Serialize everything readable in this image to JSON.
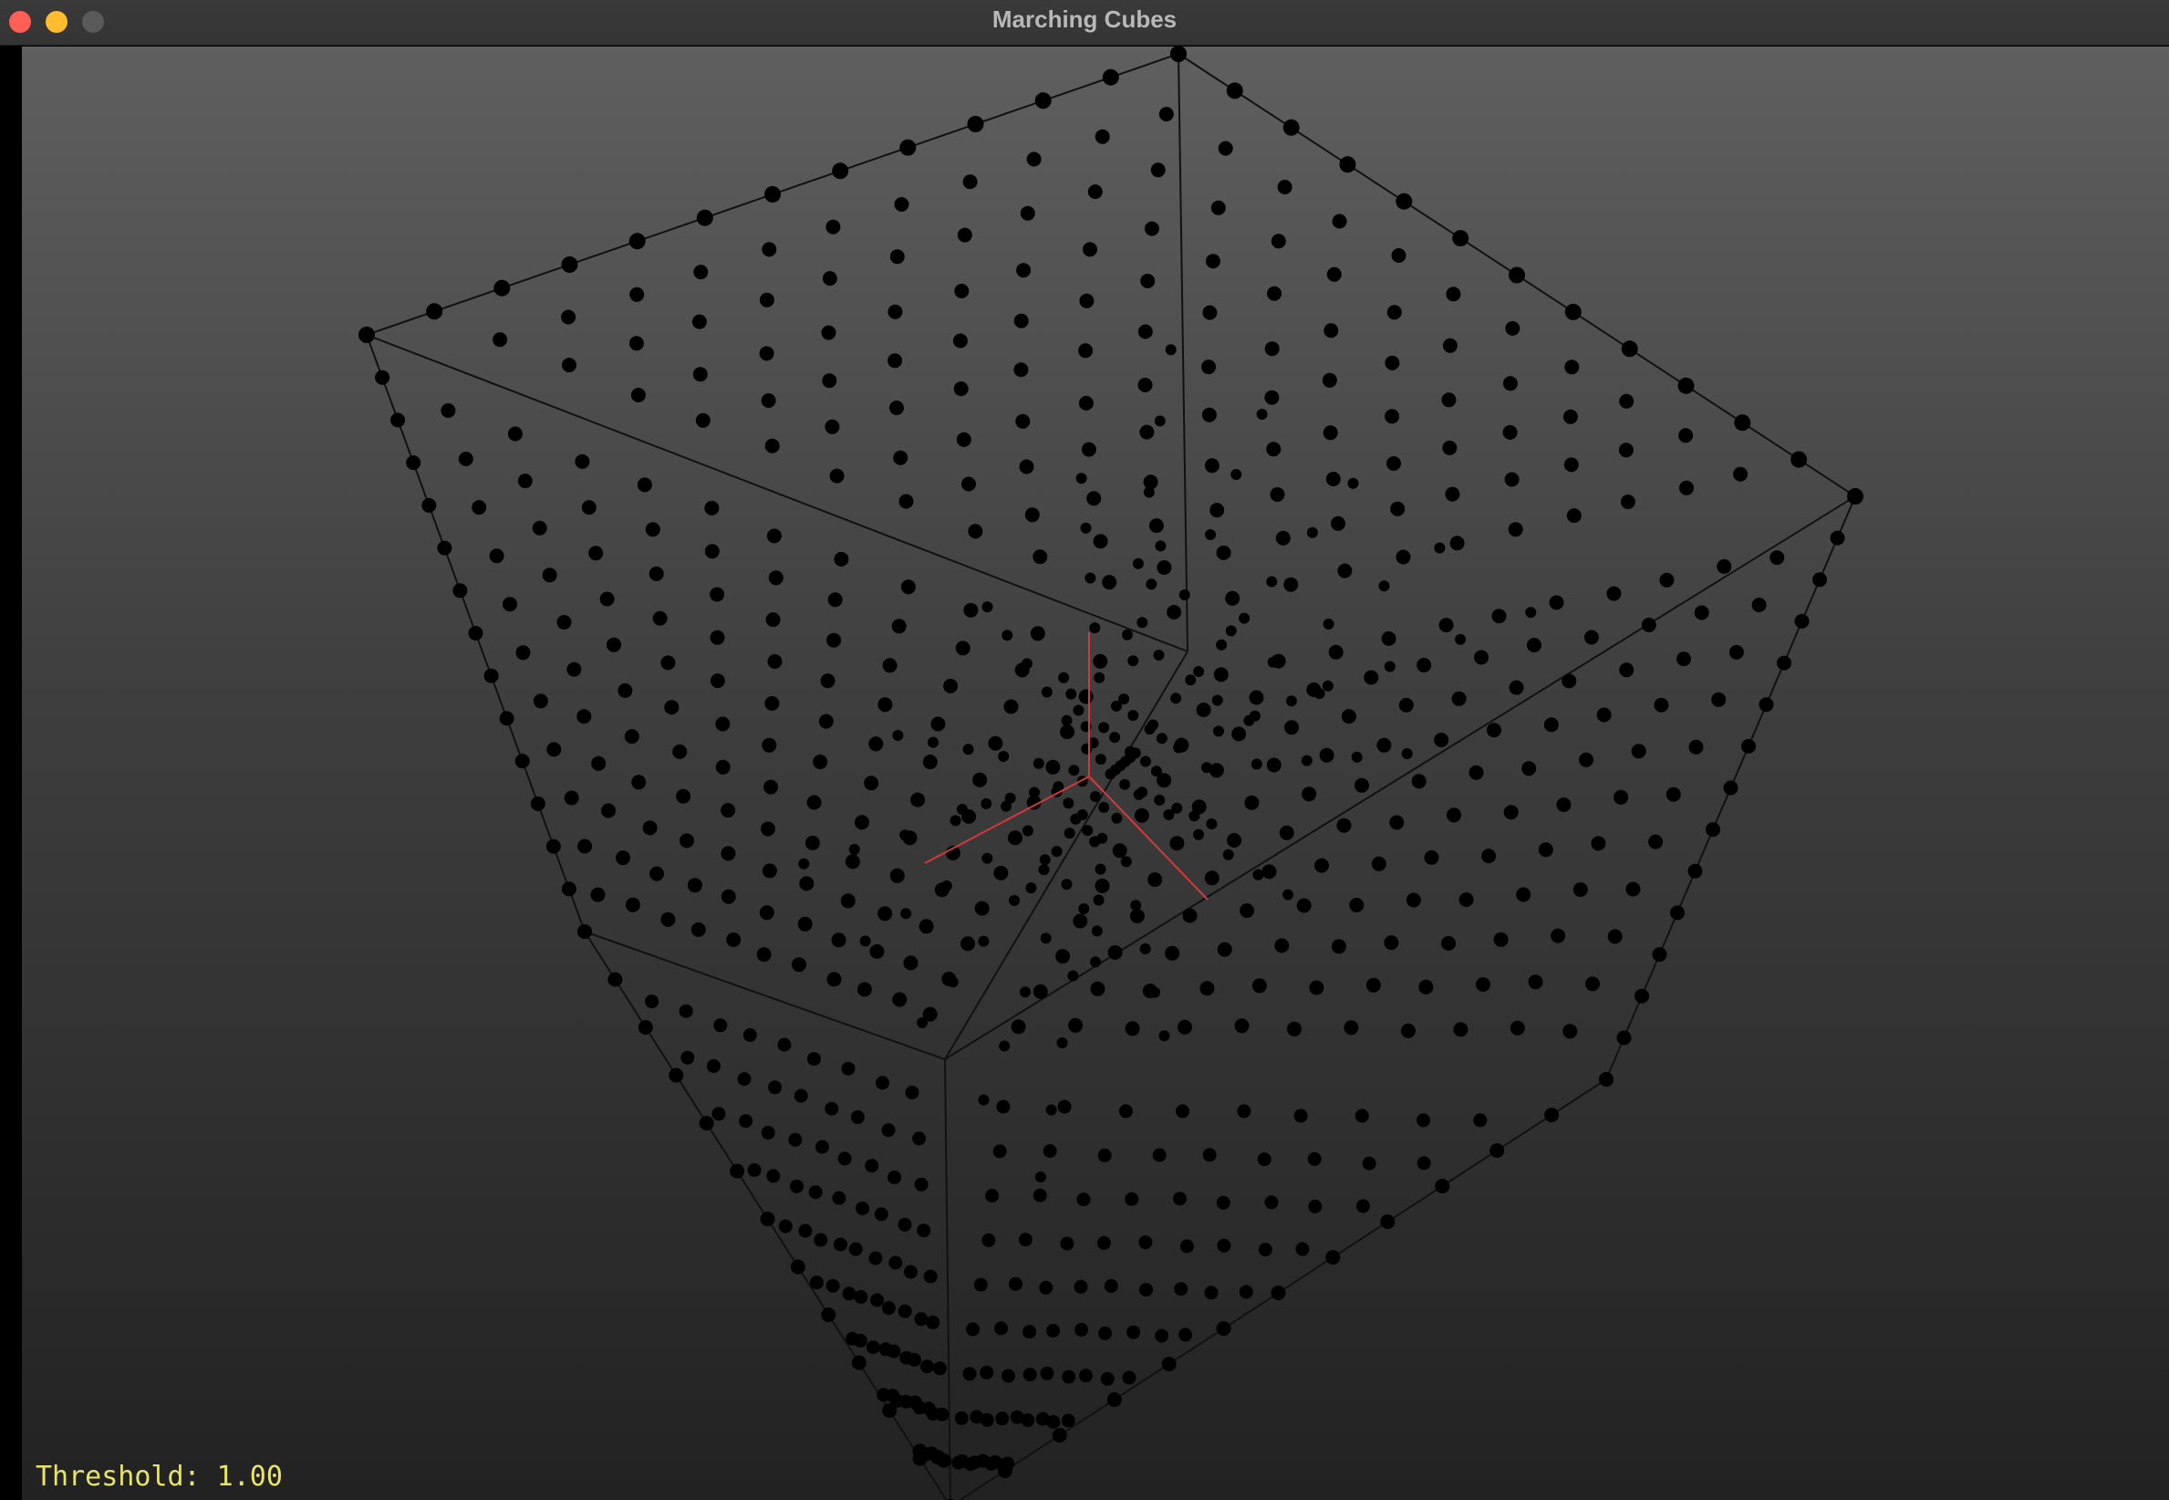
{
  "window": {
    "title": "Marching Cubes",
    "buttons": {
      "close": {
        "icon": "close-icon",
        "color": "#ff5f57"
      },
      "minimize": {
        "icon": "minimize-icon",
        "color": "#febc2e"
      },
      "zoom": {
        "icon": "zoom-icon",
        "color": "#5a5a5a"
      }
    }
  },
  "viewport": {
    "background_top": "#5f5f5f",
    "background_bottom": "#222222",
    "point_color": "#000000",
    "axis_color": "#d23a3a",
    "overlay_color": "#e8e46a",
    "threshold_text": "Threshold: 1.00"
  }
}
